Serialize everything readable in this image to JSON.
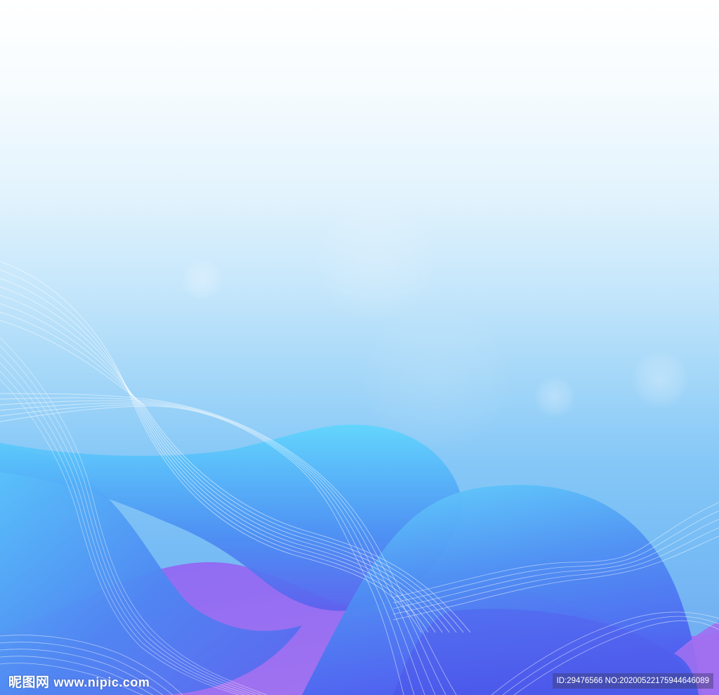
{
  "image": {
    "kind": "abstract blue wave background",
    "colors": {
      "top": "#ffffff",
      "sky_mid": "#a2d6f8",
      "wave_cyan": "#5cd0fb",
      "wave_blue": "#4a78f0",
      "wave_violet": "#9a6cf0",
      "line_color": "#ffffff"
    }
  },
  "watermark": {
    "logo_text": "昵图网",
    "site_text": "www.nipic.com",
    "id_text": "ID:29476566 NO:20200522175944646089"
  }
}
